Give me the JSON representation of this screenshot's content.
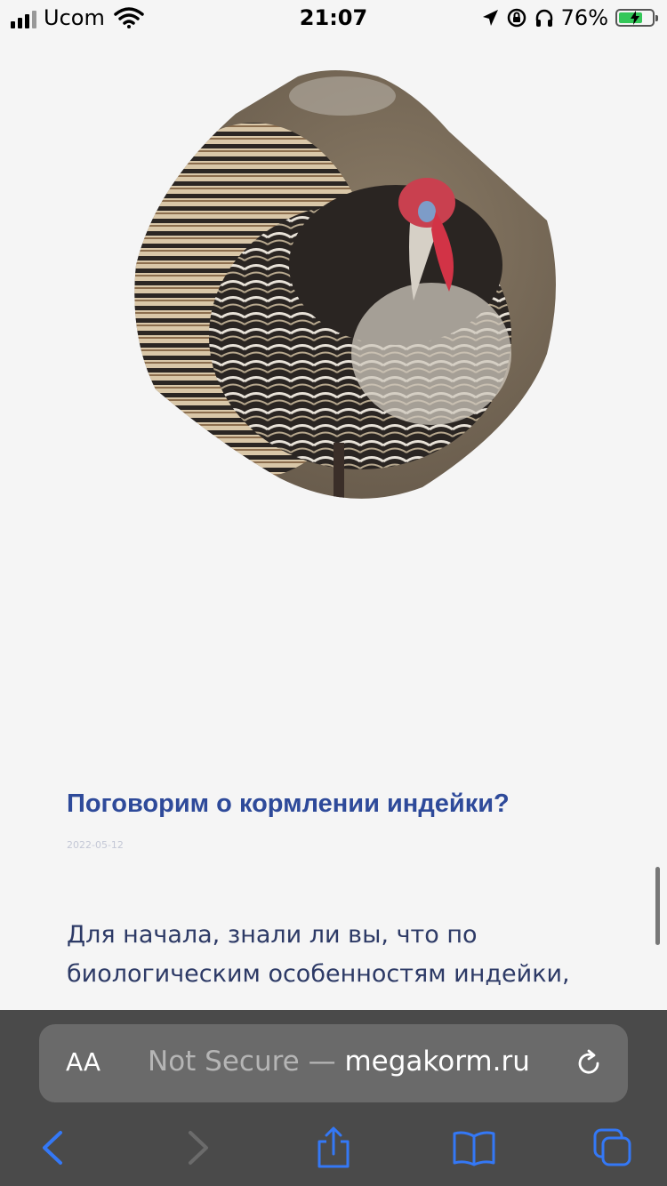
{
  "status_bar": {
    "carrier": "Ucom",
    "time": "21:07",
    "battery_percent": "76%",
    "battery_level": 0.76
  },
  "article": {
    "title": "Поговорим о кормлении индейки?",
    "date": "2022-05-12",
    "body": "Для начала, знали ли вы, что по биологическим особенностям индейки,"
  },
  "browser": {
    "text_size_label": "AA",
    "security_label": "Not Secure —",
    "domain": "megakorm.ru"
  },
  "icons": {
    "back": "chevron-left-icon",
    "forward": "chevron-right-icon",
    "share": "share-icon",
    "bookmarks": "book-icon",
    "tabs": "tabs-icon",
    "reload": "reload-icon"
  },
  "colors": {
    "accent": "#3478f6",
    "title": "#2e4a9a"
  }
}
